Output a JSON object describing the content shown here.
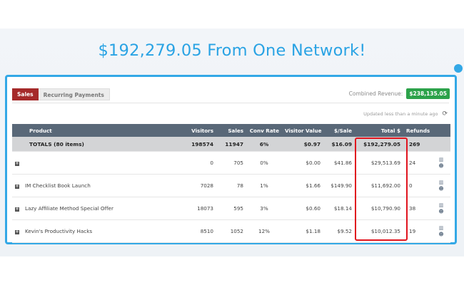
{
  "headline": "$192,279.05 From One Network!",
  "tabs": [
    {
      "label": "Sales",
      "active": true
    },
    {
      "label": "Recurring Payments",
      "active": false
    }
  ],
  "combined": {
    "label": "Combined Revenue:",
    "amount": "$238,135.05"
  },
  "updated": {
    "text": "Updated less than a minute ago",
    "icon": "refresh-icon"
  },
  "table": {
    "columns": [
      "Product",
      "Visitors",
      "Sales",
      "Conv Rate",
      "Visitor Value",
      "$/Sale",
      "Total $",
      "Refunds"
    ],
    "totals": {
      "product": "TOTALS (80 items)",
      "visitors": "198574",
      "sales": "11947",
      "conv_rate": "6%",
      "visitor_value": "$0.97",
      "per_sale": "$16.09",
      "total": "$192,279.05",
      "refunds": "269"
    },
    "rows": [
      {
        "product": "",
        "visitors": "0",
        "sales": "705",
        "conv_rate": "0%",
        "visitor_value": "$0.00",
        "per_sale": "$41.86",
        "total": "$29,513.69",
        "refunds": "24"
      },
      {
        "product": "IM Checklist Book Launch",
        "visitors": "7028",
        "sales": "78",
        "conv_rate": "1%",
        "visitor_value": "$1.66",
        "per_sale": "$149.90",
        "total": "$11,692.00",
        "refunds": "0"
      },
      {
        "product": "Lazy Affiliate Method Special Offer",
        "visitors": "18073",
        "sales": "595",
        "conv_rate": "3%",
        "visitor_value": "$0.60",
        "per_sale": "$18.14",
        "total": "$10,790.90",
        "refunds": "38"
      },
      {
        "product": "Kevin's Productivity Hacks",
        "visitors": "8510",
        "sales": "1052",
        "conv_rate": "12%",
        "visitor_value": "$1.18",
        "per_sale": "$9.52",
        "total": "$10,012.35",
        "refunds": "19"
      }
    ]
  },
  "colors": {
    "accent": "#2aa3e4",
    "active_tab": "#a52a2a",
    "revenue_badge": "#2ca24a",
    "header": "#596878",
    "highlight": "#e0141e"
  }
}
